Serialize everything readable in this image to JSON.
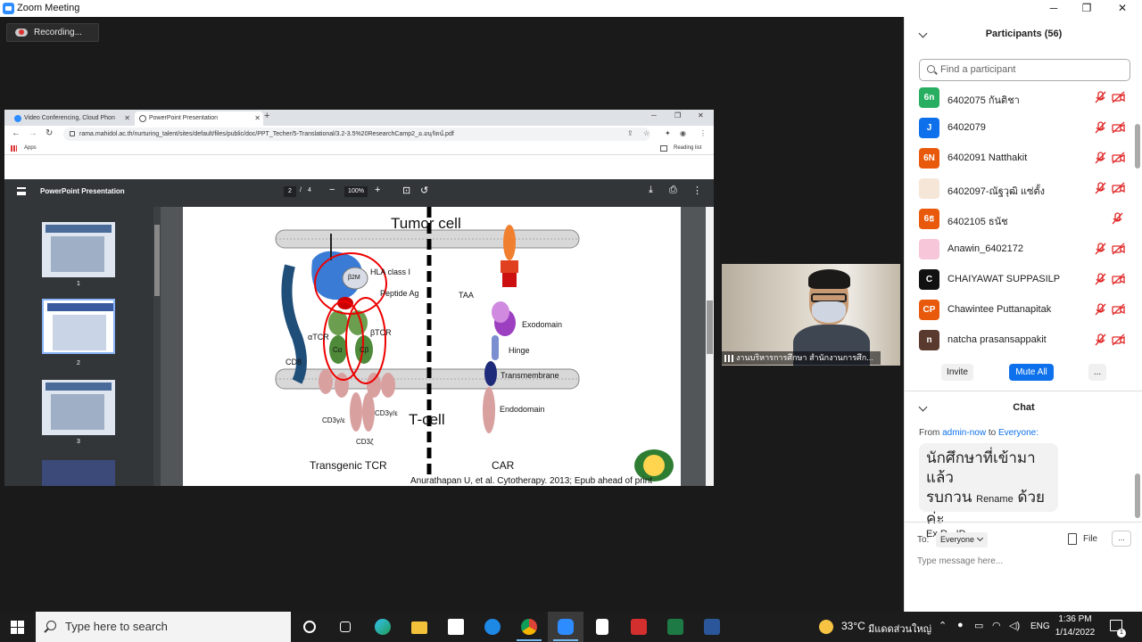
{
  "window": {
    "title": "Zoom Meeting",
    "minimize": "─",
    "maximize": "❐",
    "close": "✕"
  },
  "recording": {
    "label": "Recording..."
  },
  "browser": {
    "tabs": [
      {
        "label": "Video Conferencing, Cloud Phon"
      },
      {
        "label": "PowerPoint Presentation"
      }
    ],
    "url": "rama.mahidol.ac.th/nurturing_talent/sites/default/files/public/doc/PPT_Techer/5-Translational/3.2-3.5%20ResearchCamp2_อ.อนุรัตน์.pdf",
    "bookmarks": {
      "apps": "Apps",
      "reading_list": "Reading list"
    }
  },
  "pdf": {
    "title": "PowerPoint Presentation",
    "page_current": "2",
    "page_sep": "/",
    "page_total": "4",
    "zoom": "100%",
    "thumbnails": [
      {
        "num": "1"
      },
      {
        "num": "2"
      },
      {
        "num": "3"
      }
    ],
    "slide": {
      "tumor_cell": "Tumor cell",
      "t_cell": "T-cell",
      "hla": "HLA class I",
      "b2m": "β2M",
      "peptide": "Peptide Ag",
      "taa": "TAA",
      "exodomain": "Exodomain",
      "hinge": "Hinge",
      "transmembrane": "Transmembrane",
      "endodomain": "Endodomain",
      "atcr": "αTCR",
      "btcr": "βTCR",
      "cd8": "CD8",
      "ca": "Cα",
      "cb": "Cβ",
      "cd3_left": "CD3γ/ε",
      "cd3_right": "CD3γ/ε",
      "cd3z": "CD3ζ",
      "transgenic": "Transgenic TCR",
      "car": "CAR",
      "citation": "Anurathapan U, et al. Cytotherapy. 2013; Epub ahead of print"
    }
  },
  "video": {
    "name": "งานบริหารการศึกษา สำนักงานการศึก..."
  },
  "participants": {
    "title": "Participants (56)",
    "search_placeholder": "Find a participant",
    "list": [
      {
        "initials": "6n",
        "name": "6402075 กันติชา",
        "color": "#27ae60",
        "video_off": true
      },
      {
        "initials": "J",
        "name": "6402079",
        "color": "#0e71eb",
        "video_off": true
      },
      {
        "initials": "6N",
        "name": "6402091 Natthakit",
        "color": "#e8590c",
        "video_off": true
      },
      {
        "initials": "",
        "name": "6402097-ณัฐวุฒิ แซ่ตั้ง",
        "color": "#f5e6d8",
        "video_off": true
      },
      {
        "initials": "6ธ",
        "name": "6402105 ธนัช",
        "color": "#e8590c",
        "video_off": false
      },
      {
        "initials": "",
        "name": "Anawin_6402172",
        "color": "#f7c6d9",
        "video_off": true
      },
      {
        "initials": "C",
        "name": "CHAIYAWAT SUPPASILP",
        "color": "#111111",
        "video_off": true
      },
      {
        "initials": "CP",
        "name": "Chawintee Puttanapitak",
        "color": "#e8590c",
        "video_off": true
      },
      {
        "initials": "n",
        "name": "natcha prasansappakit",
        "color": "#5a3a2e",
        "video_off": true
      }
    ],
    "invite": "Invite",
    "mute_all": "Mute All",
    "more": "..."
  },
  "chat": {
    "title": "Chat",
    "from_label": "From",
    "from_user": "admin-now",
    "to_word": "to",
    "to_user": "Everyone:",
    "message_line1": "นักศึกษาที่เข้ามาแล้ว",
    "message_line2a": "รบกวน",
    "message_line2b": "Rename",
    "message_line2c": "ด้วยค่ะ",
    "message_line3": "Ex.R_-ID",
    "to_label": "To:",
    "to_value": "Everyone",
    "file": "File",
    "more": "...",
    "placeholder": "Type message here..."
  },
  "taskbar": {
    "search_placeholder": "Type here to search",
    "temperature": "33°C",
    "weather": "มีแดดส่วนใหญ่",
    "language": "ENG",
    "time": "1:36 PM",
    "date": "1/14/2022",
    "notifications": "1"
  }
}
